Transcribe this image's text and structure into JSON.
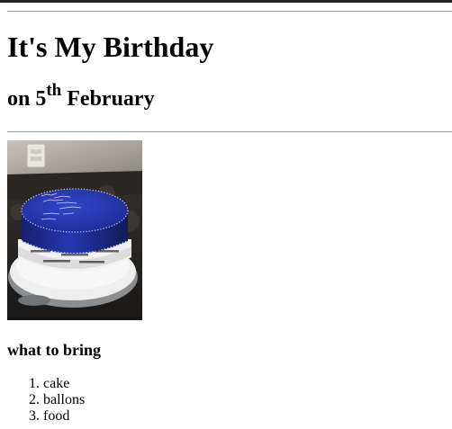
{
  "page": {
    "title": "It's My Birthday",
    "subtitle_prefix": "on 5",
    "subtitle_superscript": "th",
    "subtitle_suffix": " February"
  },
  "photo": {
    "description_icon": "birthday-cake-photo",
    "cake_color": "#1f2fa0",
    "plate_color": "#e8e8e8"
  },
  "list": {
    "heading": "what to bring",
    "items": [
      {
        "label": "cake"
      },
      {
        "label": "ballons"
      },
      {
        "label": "food"
      }
    ]
  }
}
